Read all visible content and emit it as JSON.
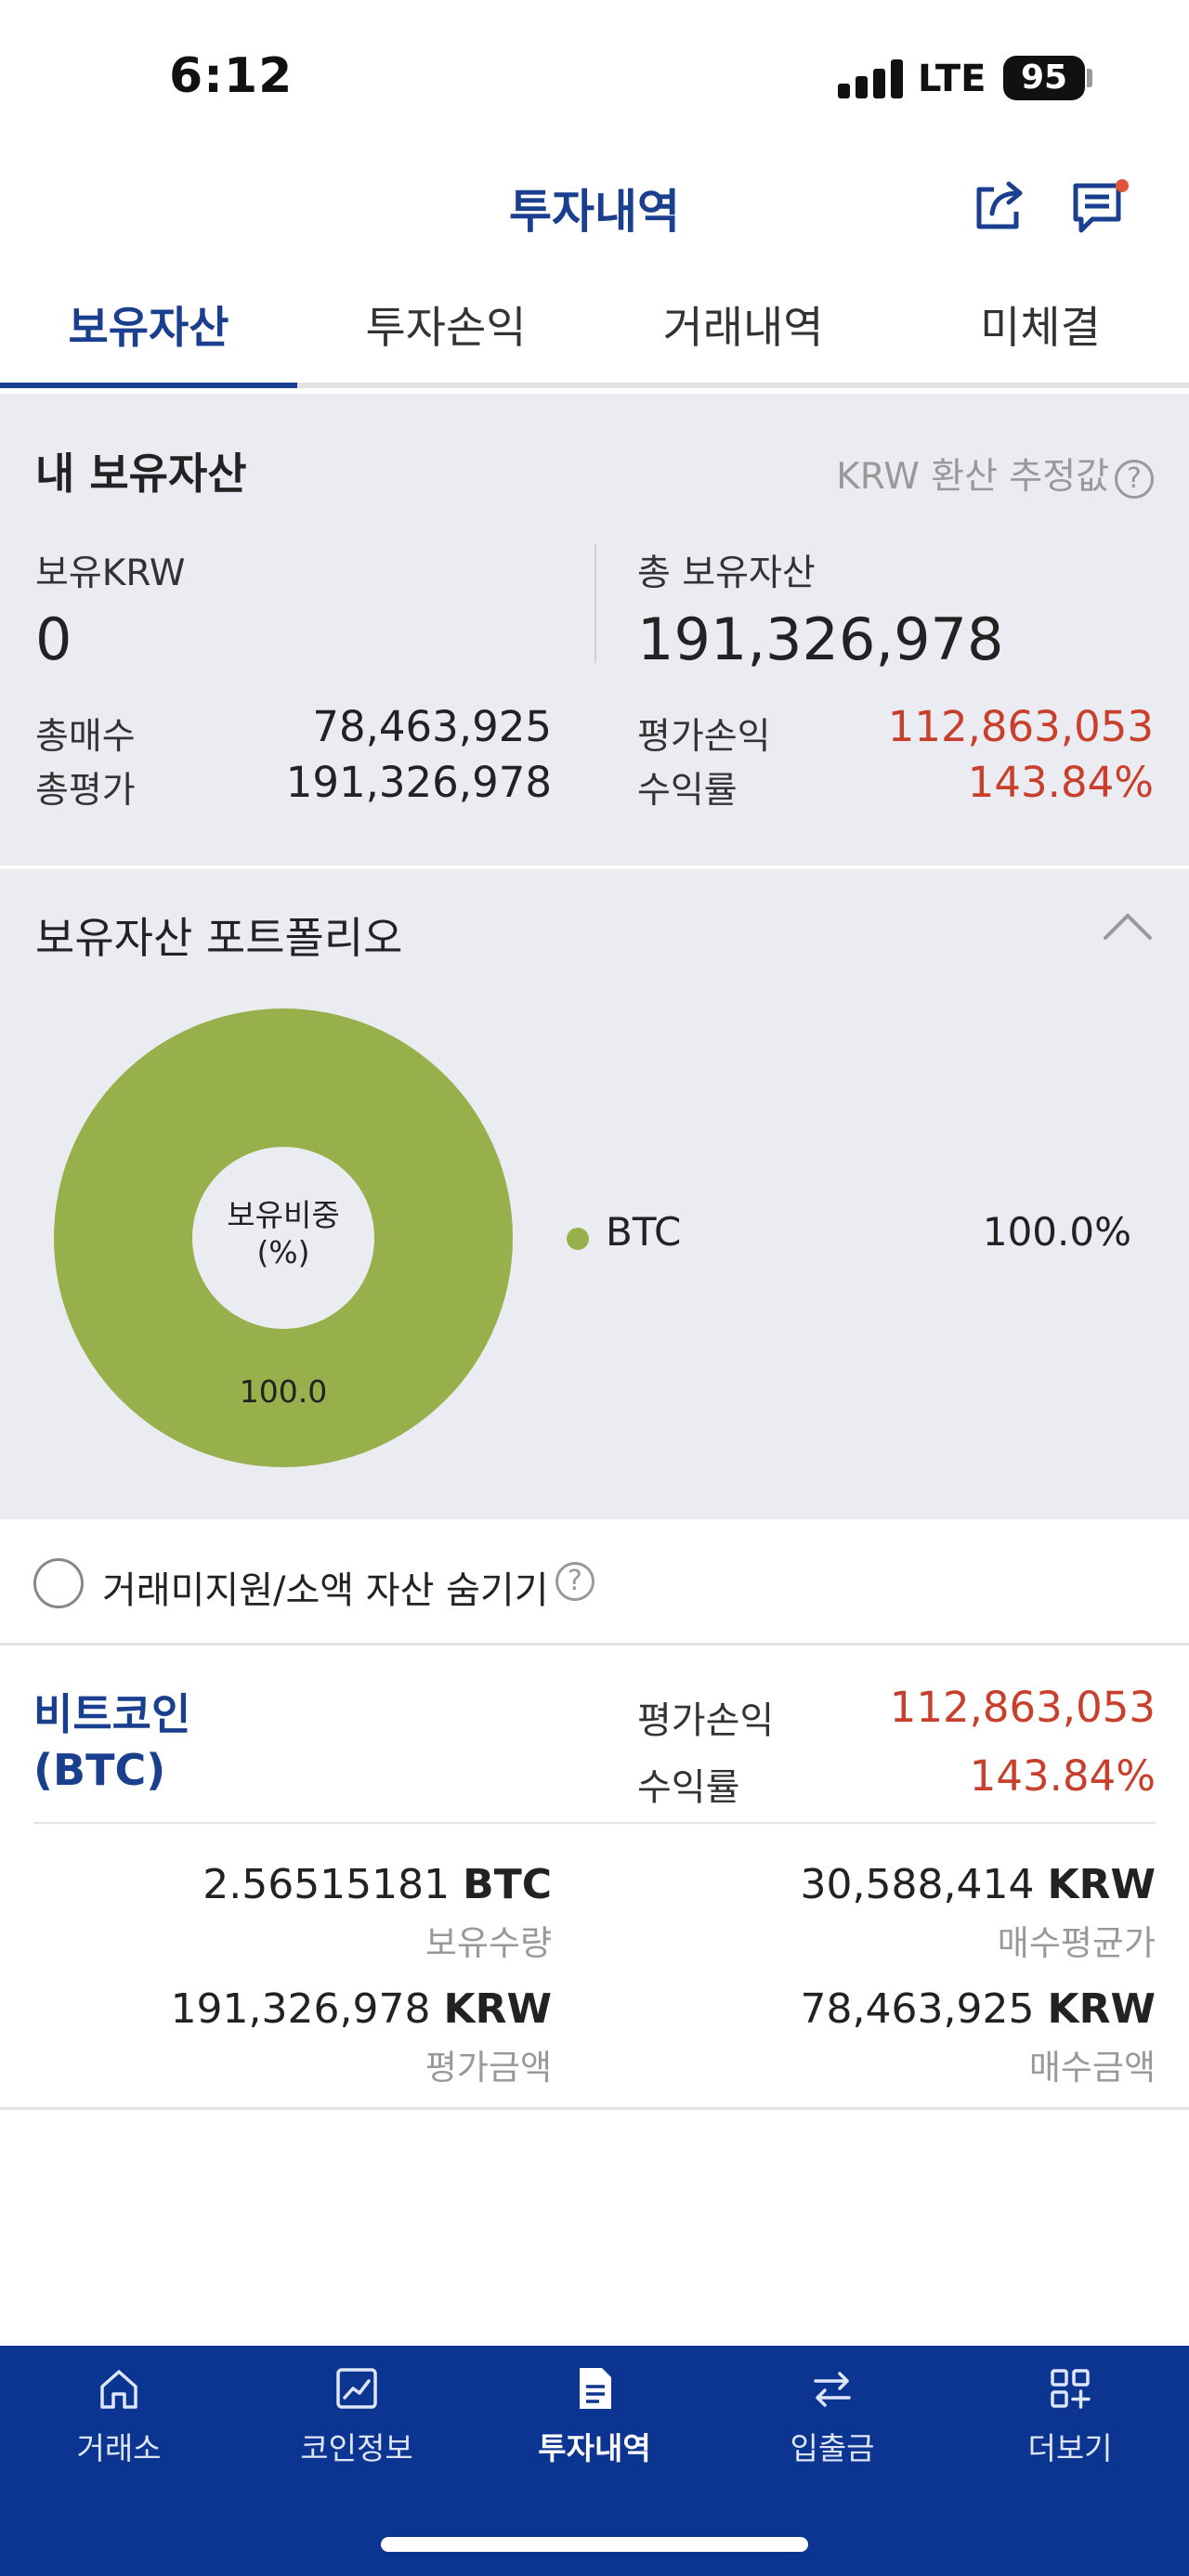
{
  "status_bar": {
    "time": "6:12",
    "network": "LTE",
    "battery": "95"
  },
  "header": {
    "title": "투자내역"
  },
  "tabs": [
    {
      "label": "보유자산"
    },
    {
      "label": "투자손익"
    },
    {
      "label": "거래내역"
    },
    {
      "label": "미체결"
    }
  ],
  "summary": {
    "title": "내 보유자산",
    "krw_note": "KRW 환산 추정값",
    "krw_label": "보유KRW",
    "krw_value": "0",
    "total_label": "총 보유자산",
    "total_value": "191,326,978",
    "buy_label": "총매수",
    "buy_value": "78,463,925",
    "eval_label": "총평가",
    "eval_value": "191,326,978",
    "pnl_label": "평가손익",
    "pnl_value": "112,863,053",
    "roi_label": "수익률",
    "roi_value": "143.84%"
  },
  "portfolio": {
    "title": "보유자산 포트폴리오",
    "donut_center_line1": "보유비중",
    "donut_center_line2": "(%)",
    "donut_value": "100.0",
    "legend": [
      {
        "name": "BTC",
        "percent": "100.0%",
        "color": "#97b04b"
      }
    ]
  },
  "chart_data": {
    "type": "pie",
    "categories": [
      "BTC"
    ],
    "values": [
      100.0
    ],
    "title": "",
    "colors": [
      "#97b04b"
    ]
  },
  "hide_toggle": {
    "label": "거래미지원/소액 자산 숨기기"
  },
  "holding": {
    "name_line1": "비트코인",
    "name_line2": "(BTC)",
    "pnl_label": "평가손익",
    "pnl_value": "112,863,053",
    "roi_label": "수익률",
    "roi_value": "143.84%",
    "qty_value": "2.56515181",
    "qty_unit": "BTC",
    "qty_label": "보유수량",
    "avg_value": "30,588,414",
    "avg_unit": "KRW",
    "avg_label": "매수평균가",
    "evalamt_value": "191,326,978",
    "evalamt_unit": "KRW",
    "evalamt_label": "평가금액",
    "buyamt_value": "78,463,925",
    "buyamt_unit": "KRW",
    "buyamt_label": "매수금액"
  },
  "bottom_nav": [
    {
      "label": "거래소",
      "icon": "home-icon"
    },
    {
      "label": "코인정보",
      "icon": "chart-icon"
    },
    {
      "label": "투자내역",
      "icon": "document-icon",
      "active": true
    },
    {
      "label": "입출금",
      "icon": "transfer-icon"
    },
    {
      "label": "더보기",
      "icon": "grid-plus-icon"
    }
  ],
  "colors": {
    "brand": "#1a3f8f",
    "nav_bg": "#0b3591",
    "positive": "#c8402c",
    "btc": "#97b04b"
  }
}
